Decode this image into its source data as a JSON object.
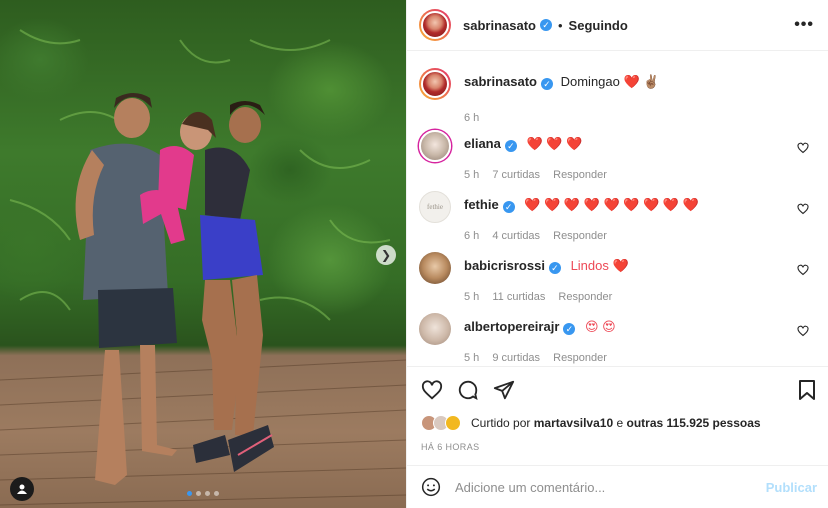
{
  "post": {
    "author": "sabrinasato",
    "follow_status": "Seguindo",
    "caption_author": "sabrinasato",
    "caption_text": "Domingao",
    "caption_emojis": "❤️ ✌🏽",
    "caption_time": "6 h"
  },
  "comments": [
    {
      "user": "eliana",
      "text": "❤️ ❤️ ❤️",
      "time": "5 h",
      "likes": "7 curtidas",
      "reply": "Responder",
      "avatar_text": ""
    },
    {
      "user": "fethie",
      "text": "❤️ ❤️ ❤️ ❤️ ❤️ ❤️ ❤️ ❤️ ❤️",
      "time": "6 h",
      "likes": "4 curtidas",
      "reply": "Responder",
      "avatar_text": "fethie"
    },
    {
      "user": "babicrisrossi",
      "text": "Lindos ❤️",
      "time": "5 h",
      "likes": "11 curtidas",
      "reply": "Responder",
      "avatar_text": ""
    },
    {
      "user": "albertopereirajr",
      "text": "😍 😍",
      "time": "5 h",
      "likes": "9 curtidas",
      "reply": "Responder",
      "avatar_text": ""
    }
  ],
  "likes_line": {
    "prefix": "Curtido por",
    "user": "martavsilva10",
    "middle": "e",
    "others": "outras 115.925 pessoas"
  },
  "post_time": "HÁ 6 HORAS",
  "composer": {
    "placeholder": "Adicione um comentário...",
    "publish": "Publicar"
  },
  "icons": {
    "more": "more-options-icon",
    "like": "heart-outline-icon",
    "comment": "comment-bubble-icon",
    "share": "paper-plane-icon",
    "save": "bookmark-icon",
    "emoji": "smiley-icon",
    "next": "chevron-right-icon",
    "tag": "person-tag-icon"
  },
  "colors": {
    "verified": "#3897f0",
    "heart": "#ed4956",
    "muted": "#8e8e8e",
    "publish_disabled": "#b2dffc"
  },
  "carousel": {
    "total": 4,
    "active": 1
  }
}
